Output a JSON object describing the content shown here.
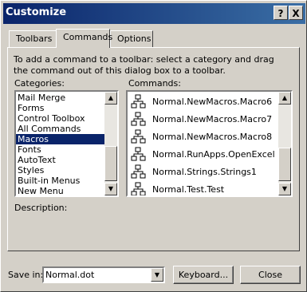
{
  "window": {
    "title": "Customize",
    "help_label": "?",
    "close_label": "X"
  },
  "tabs": [
    {
      "label": "Toolbars"
    },
    {
      "label": "Commands"
    },
    {
      "label": "Options"
    }
  ],
  "instructions": "To add a command to a toolbar: select a category and drag the command out of this dialog box to a toolbar.",
  "categories": {
    "label": "Categories:",
    "items": [
      "Mail Merge",
      "Forms",
      "Control Toolbox",
      "All Commands",
      "Macros",
      "Fonts",
      "AutoText",
      "Styles",
      "Built-in Menus",
      "New Menu"
    ],
    "selected": "Macros"
  },
  "commands": {
    "label": "Commands:",
    "items": [
      "Normal.NewMacros.Macro6",
      "Normal.NewMacros.Macro7",
      "Normal.NewMacros.Macro8",
      "Normal.RunApps.OpenExcel",
      "Normal.Strings.Strings1",
      "Normal.Test.Test"
    ],
    "icon": "macro-icon"
  },
  "description_label": "Description:",
  "save_in": {
    "label": "Save in:",
    "value": "Normal.dot"
  },
  "keyboard_button": "Keyboard...",
  "close_button": "Close"
}
